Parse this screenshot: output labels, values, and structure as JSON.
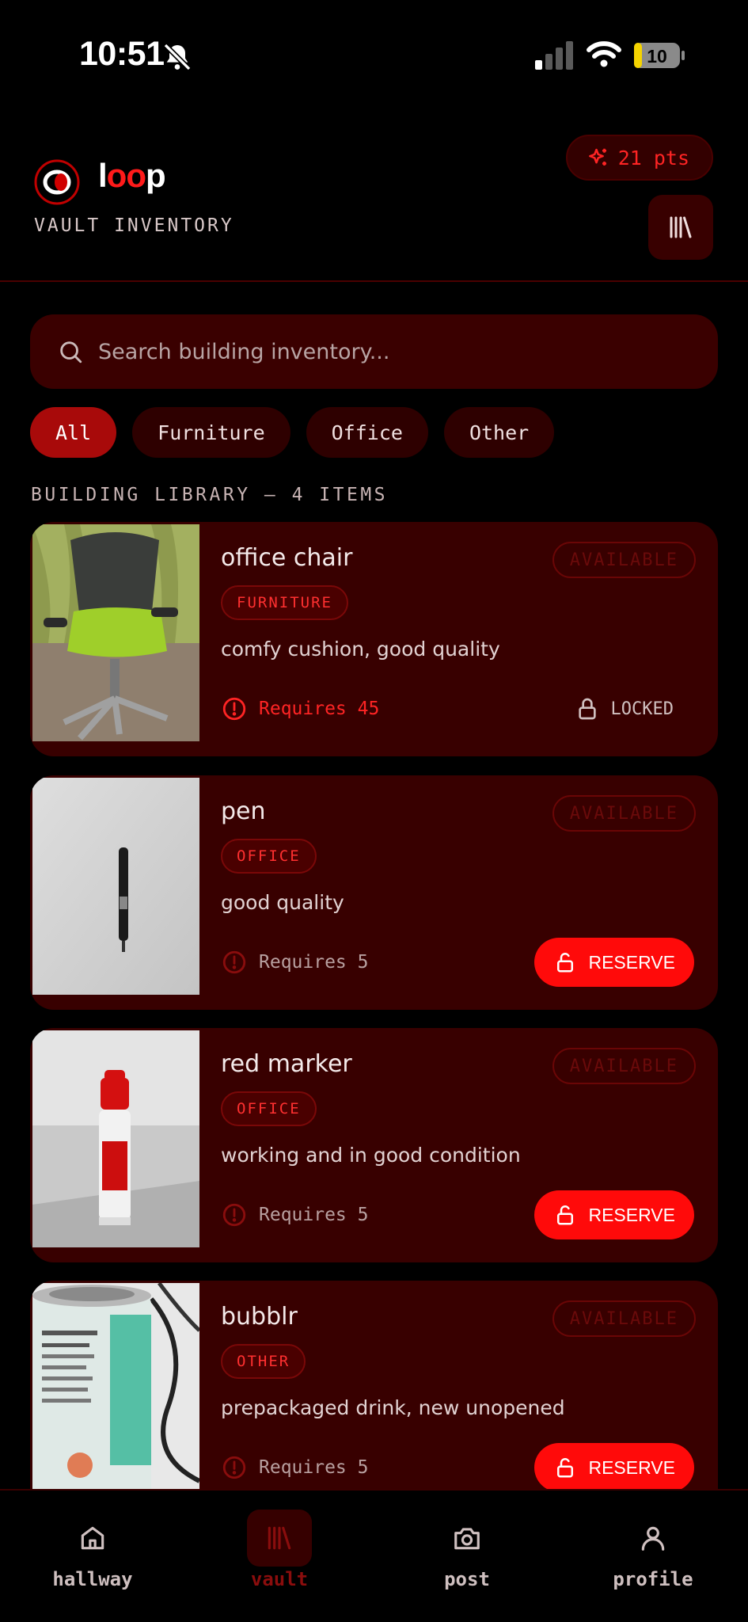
{
  "status_bar": {
    "time": "10:51",
    "battery": "10"
  },
  "header": {
    "brand": "loop",
    "subtitle": "VAULT INVENTORY",
    "points": "21 pts"
  },
  "search": {
    "placeholder": "Search building inventory..."
  },
  "filters": [
    "All",
    "Furniture",
    "Office",
    "Other"
  ],
  "section_label": "BUILDING LIBRARY — 4 ITEMS",
  "items": [
    {
      "title": "office chair",
      "status": "AVAILABLE",
      "category": "FURNITURE",
      "description": "comfy cushion, good quality",
      "requirement": "Requires 45",
      "action": "LOCKED"
    },
    {
      "title": "pen",
      "status": "AVAILABLE",
      "category": "OFFICE",
      "description": "good quality",
      "requirement": "Requires 5",
      "action": "RESERVE"
    },
    {
      "title": "red marker",
      "status": "AVAILABLE",
      "category": "OFFICE",
      "description": "working and in good condition",
      "requirement": "Requires 5",
      "action": "RESERVE"
    },
    {
      "title": "bubblr",
      "status": "AVAILABLE",
      "category": "OTHER",
      "description": "prepackaged drink, new unopened",
      "requirement": "Requires 5",
      "action": "RESERVE"
    }
  ],
  "nav": [
    "hallway",
    "vault",
    "post",
    "profile"
  ],
  "colors": {
    "accent": "#ff0a0a",
    "card": "#380000",
    "background": "#000000"
  }
}
